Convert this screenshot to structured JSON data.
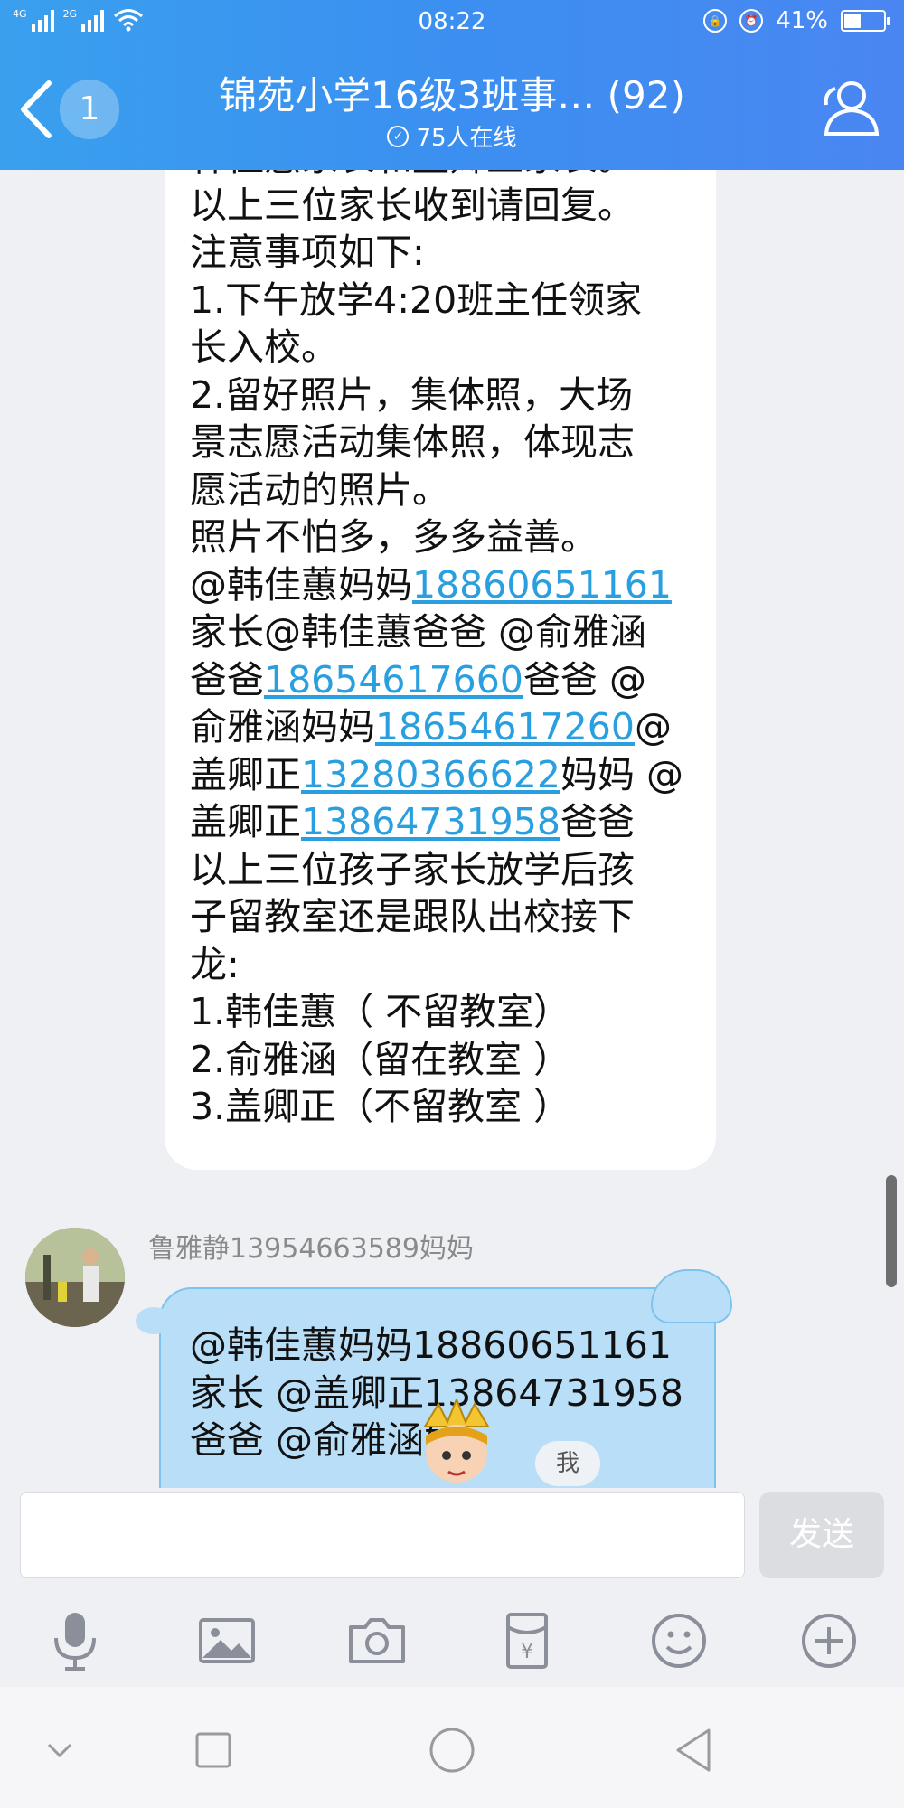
{
  "status_bar": {
    "network": "4G",
    "network2": "2G",
    "time": "08:22",
    "battery": "41%"
  },
  "header": {
    "unread": "1",
    "title": "锦苑小学16级3班事… (92)",
    "online": "75人在线"
  },
  "message1": {
    "lines": [
      "韩佳蕙家长和盖卿正家长。",
      "以上三位家长收到请回复。",
      "注意事项如下:",
      "1.下午放学4:20班主任领家",
      "长入校。",
      "2.留好照片，集体照，大场",
      "景志愿活动集体照，体现志",
      "愿活动的照片。",
      "照片不怕多，多多益善。"
    ],
    "line10_pre": "@韩佳蕙妈妈",
    "phone1": "18860651161",
    "line11": "家长@韩佳蕙爸爸 @俞雅涵",
    "line12_pre": "爸爸",
    "phone2": "18654617660",
    "line12_post": "爸爸  @",
    "line13_pre": "俞雅涵妈妈",
    "phone3": "18654617260",
    "line13_post": "@",
    "line14_pre": "盖卿正",
    "phone4": "13280366622",
    "line14_post": "妈妈 @",
    "line15_pre": "盖卿正",
    "phone5": "13864731958",
    "line15_post": "爸爸",
    "lines_after": [
      "以上三位孩子家长放学后孩",
      "子留教室还是跟队出校接下",
      "龙:",
      "1.韩佳蕙（  不留教室）",
      "2.俞雅涵（留在教室  ）",
      "3.盖卿正（不留教室  ）"
    ]
  },
  "message2": {
    "sender": "鲁雅静13954663589妈妈",
    "lines": [
      "@韩佳蕙妈妈18860651161",
      "家长 @盖卿正13864731958",
      "爸爸 @俞雅涵妈"
    ],
    "me_badge": "我"
  },
  "input": {
    "placeholder": "",
    "send_label": "发送"
  },
  "toolbar": {
    "icons": [
      "microphone-icon",
      "image-icon",
      "camera-icon",
      "red-packet-icon",
      "emoji-icon",
      "plus-icon"
    ]
  },
  "colors": {
    "header": "#3b8ff0",
    "link": "#2a9fe0",
    "bubble_self": "#b9def7"
  }
}
